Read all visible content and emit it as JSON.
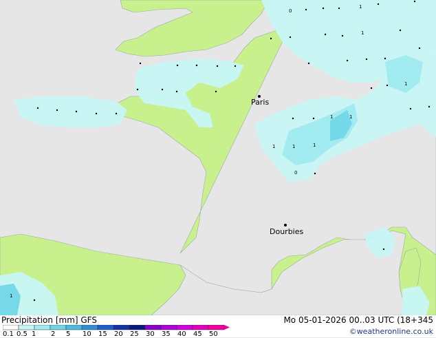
{
  "map": {
    "cities": [
      {
        "name": "Paris"
      },
      {
        "name": "Dourbies"
      }
    ],
    "precip_labels": [
      "1",
      "0",
      "1",
      "1",
      "1",
      "1",
      "1",
      "1",
      "0",
      "1",
      "1"
    ]
  },
  "footer": {
    "legend_title": "Precipitation [mm]  GFS",
    "valid_time": "Mo 05-01-2026 00..03 UTC (18+345",
    "copyright": "©weatheronline.co.uk",
    "scale": {
      "ticks": [
        "0.1",
        "0.5",
        "1",
        "2",
        "5",
        "10",
        "15",
        "20",
        "25",
        "30",
        "35",
        "40",
        "45",
        "50"
      ],
      "colors": [
        "#ffffff",
        "#c8f5f5",
        "#9eeaf0",
        "#6ed6e6",
        "#4bbce0",
        "#2f8fd8",
        "#1f5fc8",
        "#1434a8",
        "#0a1a80",
        "#8a00c8",
        "#b000d8",
        "#d000e0",
        "#e000c0",
        "#f000a0"
      ]
    }
  },
  "colors": {
    "land": "#c8f08c",
    "sea": "#e6e6e6",
    "precip_light": "#c8f5f5",
    "precip_mid": "#9eeaf0",
    "precip_high": "#6ed6e6"
  }
}
